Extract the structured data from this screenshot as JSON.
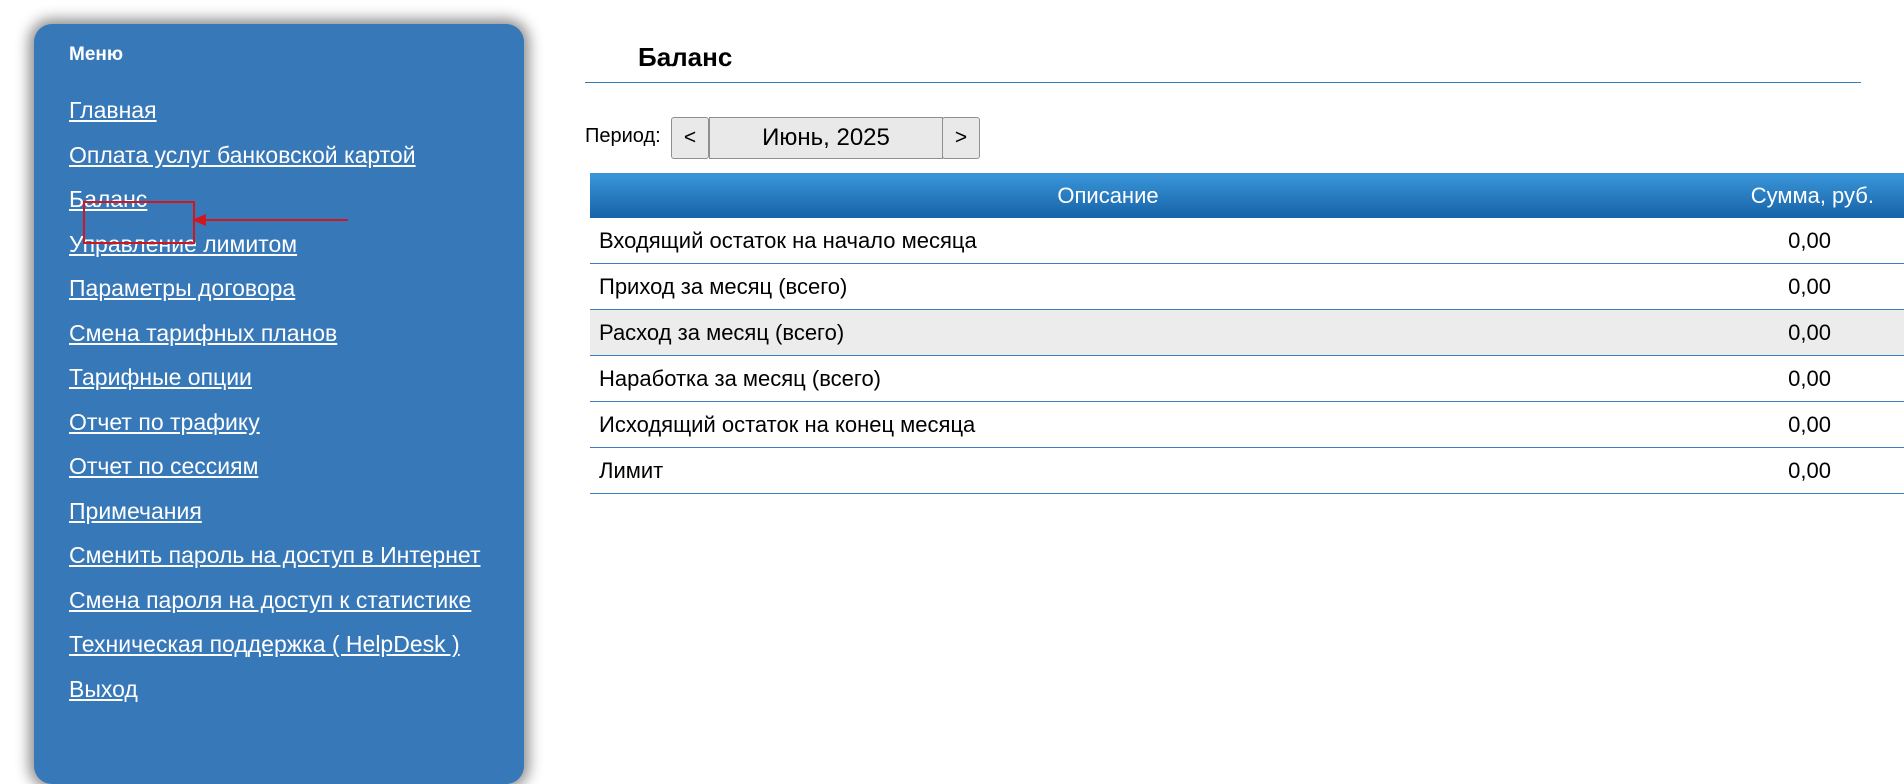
{
  "sidebar": {
    "title": "Меню",
    "items": [
      {
        "label": "Главная"
      },
      {
        "label": "Оплата услуг банковской картой"
      },
      {
        "label": "Баланс"
      },
      {
        "label": "Управление лимитом"
      },
      {
        "label": "Параметры договора"
      },
      {
        "label": "Смена тарифных планов"
      },
      {
        "label": "Тарифные опции"
      },
      {
        "label": "Отчет по трафику"
      },
      {
        "label": "Отчет по сессиям"
      },
      {
        "label": "Примечания"
      },
      {
        "label": "Сменить пароль на доступ в Интернет"
      },
      {
        "label": "Смена пароля на доступ к статистике"
      },
      {
        "label": "Техническая поддержка ( HelpDesk )"
      },
      {
        "label": "Выход"
      }
    ]
  },
  "main": {
    "title": "Баланс",
    "period": {
      "label": "Период:",
      "prev_label": "<",
      "value": "Июнь, 2025",
      "next_label": ">"
    },
    "table": {
      "headers": {
        "description": "Описание",
        "amount": "Сумма, руб."
      },
      "rows": [
        {
          "description": "Входящий остаток на начало месяца",
          "amount": "0,00"
        },
        {
          "description": "Приход за месяц (всего)",
          "amount": "0,00"
        },
        {
          "description": "Расход за месяц (всего)",
          "amount": "0,00"
        },
        {
          "description": "Наработка за месяц (всего)",
          "amount": "0,00"
        },
        {
          "description": "Исходящий остаток на конец месяца",
          "amount": "0,00"
        },
        {
          "description": "Лимит",
          "amount": "0,00"
        }
      ]
    }
  },
  "colors": {
    "sidebar_bg": "#3778b9",
    "header_gradient_top": "#3a97d9",
    "header_gradient_bottom": "#1762a9",
    "row_divider": "#3f7dc0",
    "alt_row_bg": "#ececec",
    "annotation_red": "#d0161f"
  }
}
